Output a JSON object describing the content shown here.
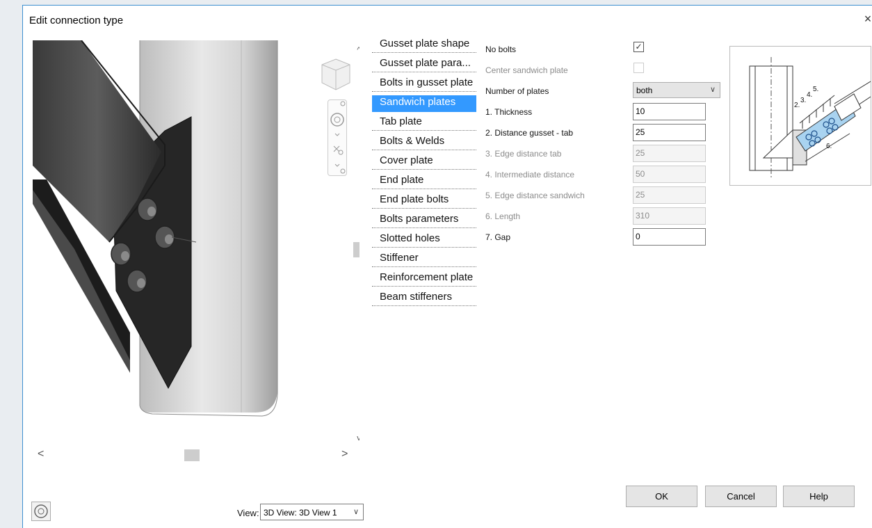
{
  "dialog": {
    "title": "Edit connection type",
    "close_glyph": "×"
  },
  "categories": [
    {
      "label": "Gusset plate shape",
      "selected": false
    },
    {
      "label": "Gusset plate para...",
      "selected": false
    },
    {
      "label": "Bolts in gusset plate",
      "selected": false
    },
    {
      "label": "Sandwich plates",
      "selected": true
    },
    {
      "label": "Tab plate",
      "selected": false
    },
    {
      "label": "Bolts & Welds",
      "selected": false
    },
    {
      "label": "Cover plate",
      "selected": false
    },
    {
      "label": "End plate",
      "selected": false
    },
    {
      "label": "End plate bolts",
      "selected": false
    },
    {
      "label": "Bolts  parameters",
      "selected": false
    },
    {
      "label": "Slotted holes",
      "selected": false
    },
    {
      "label": "Stiffener",
      "selected": false
    },
    {
      "label": "Reinforcement plate",
      "selected": false
    },
    {
      "label": "Beam stiffeners",
      "selected": false
    }
  ],
  "properties": {
    "no_bolts": {
      "label": "No bolts",
      "checked": true,
      "check_glyph": "✓"
    },
    "center_sandwich_plate": {
      "label": "Center sandwich plate",
      "checked": false
    },
    "number_of_plates": {
      "label": "Number of plates",
      "value": "both"
    },
    "thickness": {
      "label": "1. Thickness",
      "value": "10"
    },
    "distance_gusset_tab": {
      "label": "2. Distance gusset - tab",
      "value": "25"
    },
    "edge_distance_tab": {
      "label": "3. Edge distance tab",
      "value": "25"
    },
    "intermediate_distance": {
      "label": "4. Intermediate distance",
      "value": "50"
    },
    "edge_distance_sandwich": {
      "label": "5. Edge distance sandwich",
      "value": "25"
    },
    "length": {
      "label": "6. Length",
      "value": "310"
    },
    "gap": {
      "label": "7. Gap",
      "value": "0"
    }
  },
  "preview": {
    "dimension_labels": [
      "2.",
      "3.",
      "4.",
      "5.",
      "6."
    ]
  },
  "buttons": {
    "ok": "OK",
    "cancel": "Cancel",
    "help": "Help"
  },
  "view": {
    "label": "View:",
    "value": "3D View: 3D View 1"
  },
  "scrollbars": {
    "up": "^",
    "down": "v",
    "left": "<",
    "right": ">"
  },
  "icons": {
    "chevron_down": "∨"
  },
  "colors": {
    "selection": "#3399ff",
    "border_accent": "#3c8fd0",
    "steel_dark": "#2a2a2a",
    "steel_light": "#d0d0d0"
  }
}
